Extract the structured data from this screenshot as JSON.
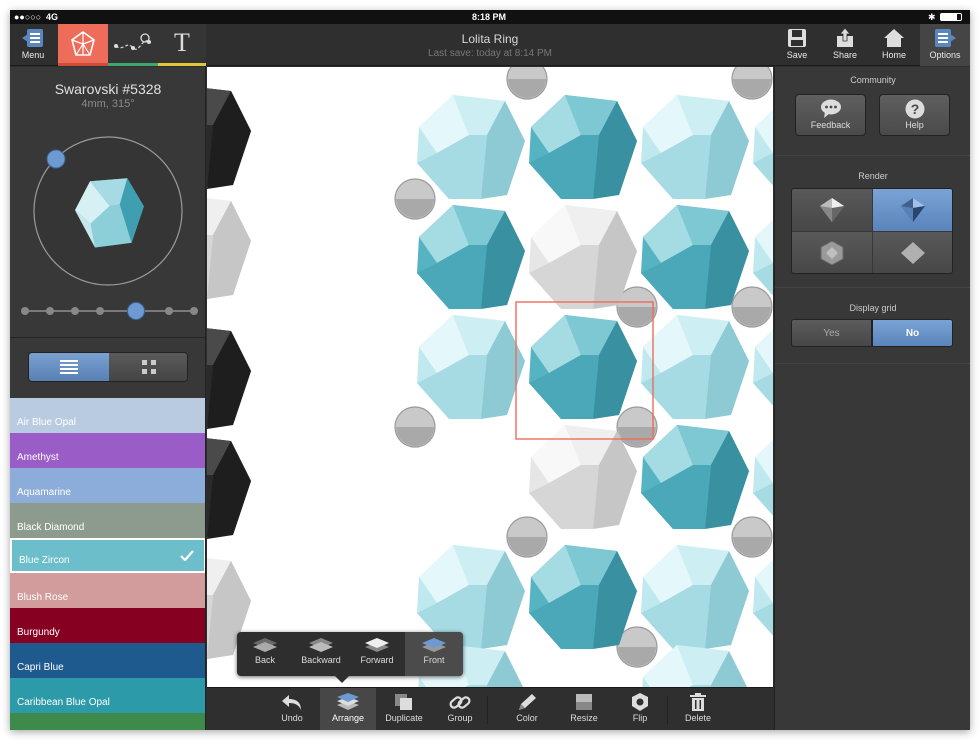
{
  "status": {
    "signal": "●●○○○",
    "network": "4G",
    "time": "8:18 PM"
  },
  "toolbar": {
    "menu_label": "Menu",
    "title": "Lolita Ring",
    "subtitle": "Last save: today at 8:14 PM",
    "save_label": "Save",
    "share_label": "Share",
    "home_label": "Home",
    "options_label": "Options",
    "text_tool_glyph": "T",
    "tool_colors": {
      "bead": "#ee6c5a",
      "wire": "#3fa870",
      "text": "#e2c63a"
    }
  },
  "bead": {
    "name": "Swarovski #5328",
    "specs": "4mm, 315°",
    "rotation_level": 0.73
  },
  "view_toggle": {
    "list_icon": "list-icon",
    "grid_icon": "grid-icon",
    "selected": "list"
  },
  "colors": [
    {
      "name": "Air Blue Opal",
      "color": "#b9cbe0"
    },
    {
      "name": "Amethyst",
      "color": "#9a5cc6"
    },
    {
      "name": "Aquamarine",
      "color": "#8cadd9"
    },
    {
      "name": "Black Diamond",
      "color": "#8d9b8e"
    },
    {
      "name": "Blue Zircon",
      "color": "#6cbfca",
      "selected": true
    },
    {
      "name": "Blush Rose",
      "color": "#d19c9b"
    },
    {
      "name": "Burgundy",
      "color": "#860021"
    },
    {
      "name": "Capri Blue",
      "color": "#1e5a8e"
    },
    {
      "name": "Caribbean Blue Opal",
      "color": "#2c9aa9"
    }
  ],
  "arrange_popup": {
    "back": "Back",
    "backward": "Backward",
    "forward": "Forward",
    "front": "Front"
  },
  "bottom_toolbar": {
    "undo": "Undo",
    "arrange": "Arrange",
    "duplicate": "Duplicate",
    "group": "Group",
    "color": "Color",
    "resize": "Resize",
    "flip": "Flip",
    "delete": "Delete"
  },
  "options": {
    "community_header": "Community",
    "feedback_label": "Feedback",
    "help_label": "Help",
    "render_header": "Render",
    "display_grid_header": "Display grid",
    "yes_label": "Yes",
    "no_label": "No",
    "display_grid_value": "No"
  },
  "accent_color": "#5b87bf"
}
